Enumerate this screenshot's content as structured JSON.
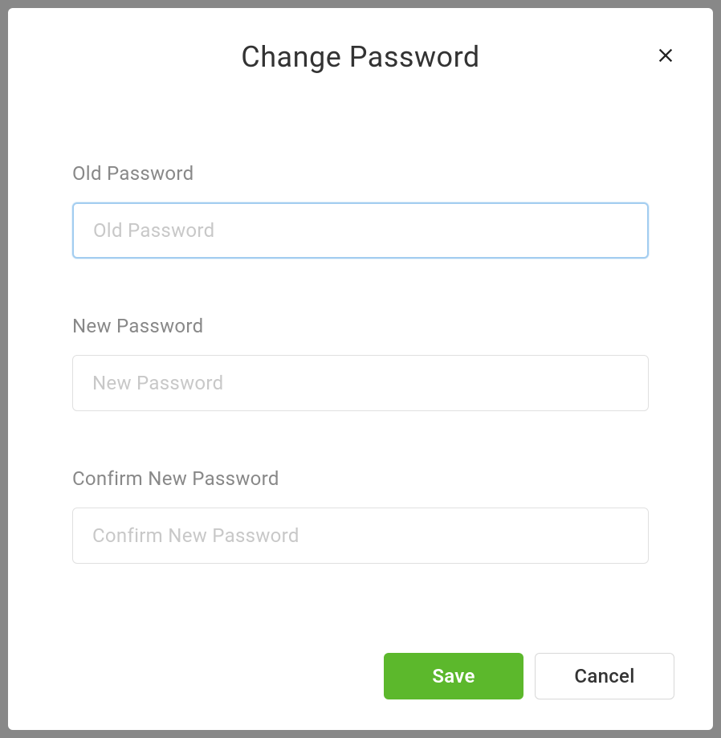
{
  "modal": {
    "title": "Change Password",
    "fields": {
      "old_password": {
        "label": "Old Password",
        "placeholder": "Old Password",
        "value": ""
      },
      "new_password": {
        "label": "New Password",
        "placeholder": "New Password",
        "value": ""
      },
      "confirm_password": {
        "label": "Confirm New Password",
        "placeholder": "Confirm New Password",
        "value": ""
      }
    },
    "buttons": {
      "save": "Save",
      "cancel": "Cancel"
    }
  }
}
